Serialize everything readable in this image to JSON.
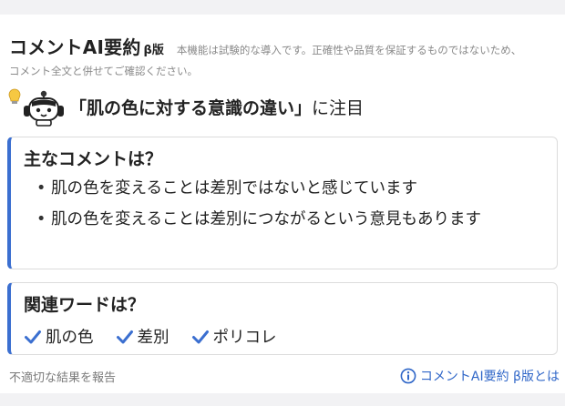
{
  "header": {
    "title": "コメントAI要約",
    "beta_label": "β版",
    "disclaimer_line1": "本機能は試験的な導入です。正確性や品質を保証するものではないため、",
    "disclaimer_line2": "コメント全文と併せてご確認ください。"
  },
  "headline": {
    "quote": "「肌の色に対する意識の違い」",
    "suffix": "に注目"
  },
  "comments_card": {
    "title": "主なコメントは？",
    "items": [
      "肌の色を変えることは差別ではないと感じています",
      "肌の色を変えることは差別につながるという意見もあります"
    ]
  },
  "words_card": {
    "title": "関連ワードは？",
    "tags": [
      "肌の色",
      "差別",
      "ポリコレ"
    ]
  },
  "footer": {
    "report_link": "不適切な結果を報告",
    "about_link": "コメントAI要約 β版とは"
  },
  "colors": {
    "accent": "#3b6fd0",
    "muted_text": "#8a8a8a"
  },
  "icons": {
    "mascot": "robot-mascot-icon",
    "lightbulb": "lightbulb-icon",
    "check": "check-icon",
    "info": "info-icon"
  }
}
